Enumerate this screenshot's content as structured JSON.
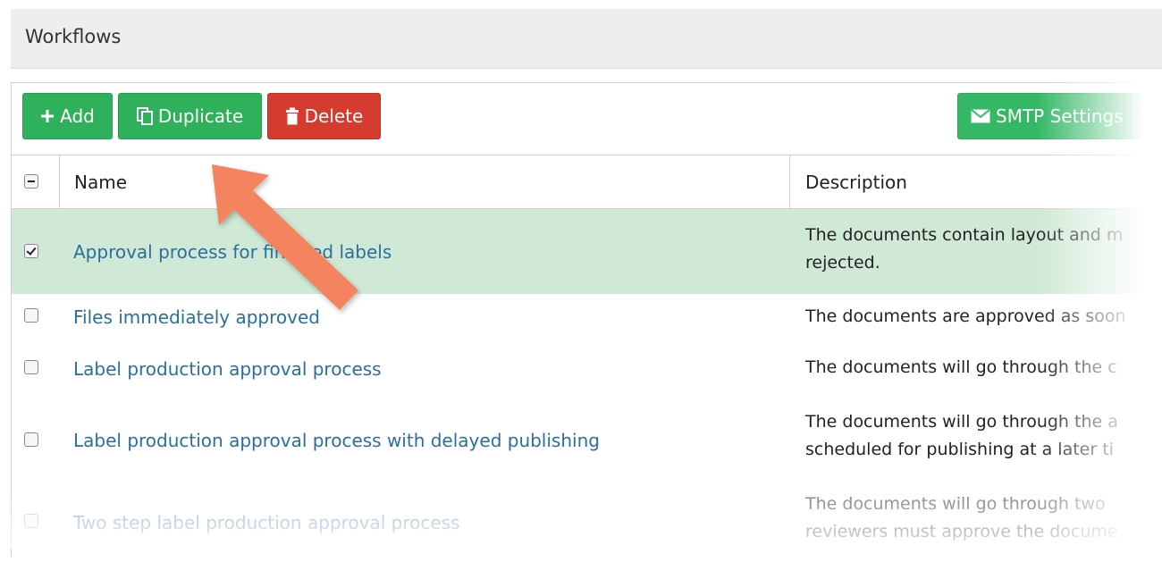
{
  "panel": {
    "title": "Workflows"
  },
  "toolbar": {
    "add_label": "Add",
    "duplicate_label": "Duplicate",
    "delete_label": "Delete",
    "smtp_label": "SMTP Settings"
  },
  "table": {
    "columns": {
      "name": "Name",
      "description": "Description"
    },
    "rows": [
      {
        "name": "Approval process for finished labels",
        "desc1": "The documents contain layout and m",
        "desc2": "rejected.",
        "checked": true,
        "selected": true
      },
      {
        "name": "Files immediately approved",
        "desc1": "The documents are approved as soon",
        "desc2": "",
        "checked": false,
        "selected": false
      },
      {
        "name": "Label production approval process",
        "desc1": "The documents will go through the c",
        "desc2": "",
        "checked": false,
        "selected": false
      },
      {
        "name": "Label production approval process with delayed publishing",
        "desc1": "The documents will go through the a",
        "desc2": "scheduled for publishing at a later ti",
        "checked": false,
        "selected": false
      },
      {
        "name": "Two step label production approval process",
        "desc1": "The documents will go through two",
        "desc2": "reviewers must approve the docume",
        "checked": false,
        "selected": false
      }
    ]
  },
  "colors": {
    "green": "#2eb15a",
    "red": "#d63b2f",
    "selected_row": "#cfe9d6",
    "link": "#2a6f9e",
    "arrow": "#f4845f"
  },
  "icons": {
    "add": "plus-icon",
    "duplicate": "copy-icon",
    "delete": "trash-icon",
    "smtp": "envelope-icon",
    "annotation": "arrow-annotation"
  }
}
